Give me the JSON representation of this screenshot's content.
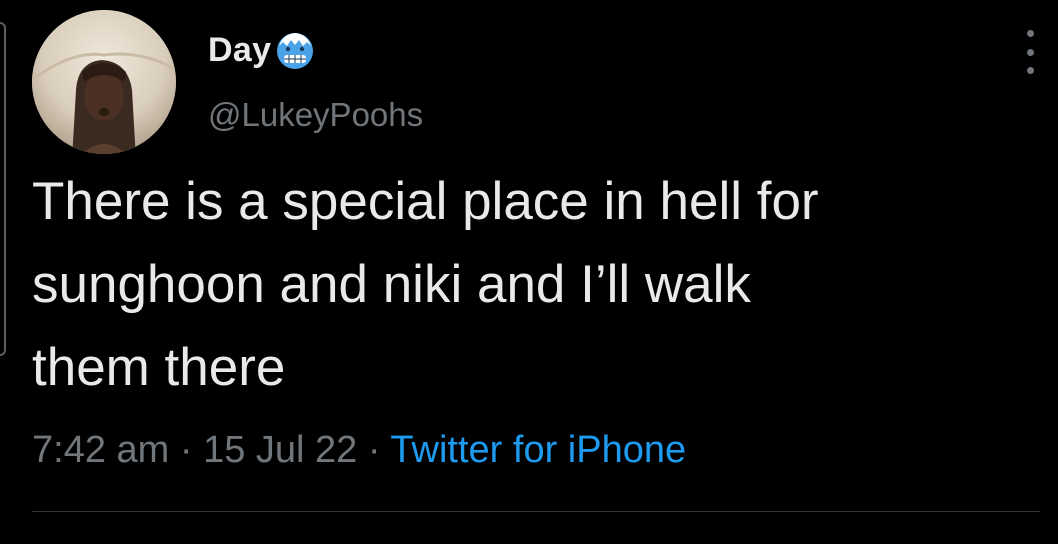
{
  "author": {
    "display_name": "Day",
    "name_emoji": "cold-face-icon",
    "handle": "@LukeyPoohs"
  },
  "tweet": {
    "text": "There is a special place in hell for\nsunghoon and niki and I’ll walk\nthem there"
  },
  "meta": {
    "time": "7:42 am",
    "separator": "·",
    "date": "15 Jul 22",
    "source": "Twitter for iPhone"
  },
  "colors": {
    "background": "#000000",
    "primary_text": "#e7e9ea",
    "secondary_text": "#71767b",
    "link": "#1d9bf0",
    "divider": "#2f3336",
    "emoji_face": "#4aa3e8"
  },
  "icons": {
    "more": "more-options-icon"
  }
}
